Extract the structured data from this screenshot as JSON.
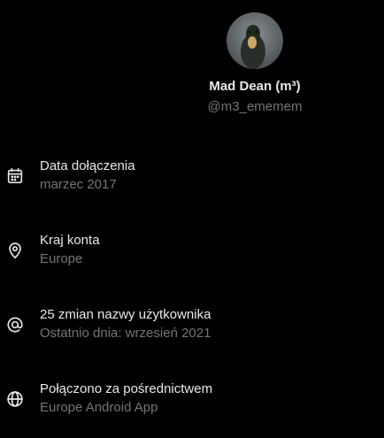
{
  "profile": {
    "display_name": "Mad Dean (m³)",
    "handle": "@m3_ememem"
  },
  "info": [
    {
      "icon": "calendar-icon",
      "title": "Data dołączenia",
      "subtitle": "marzec 2017"
    },
    {
      "icon": "location-pin-icon",
      "title": "Kraj konta",
      "subtitle": "Europe"
    },
    {
      "icon": "at-sign-icon",
      "title": "25 zmian nazwy użytkownika",
      "subtitle": "Ostatnio dnia: wrzesień 2021"
    },
    {
      "icon": "globe-icon",
      "title": "Połączono za pośrednictwem",
      "subtitle": "Europe Android App"
    }
  ],
  "colors": {
    "background": "#000000",
    "primary_text": "#e7e9ea",
    "secondary_text": "#71767b"
  }
}
